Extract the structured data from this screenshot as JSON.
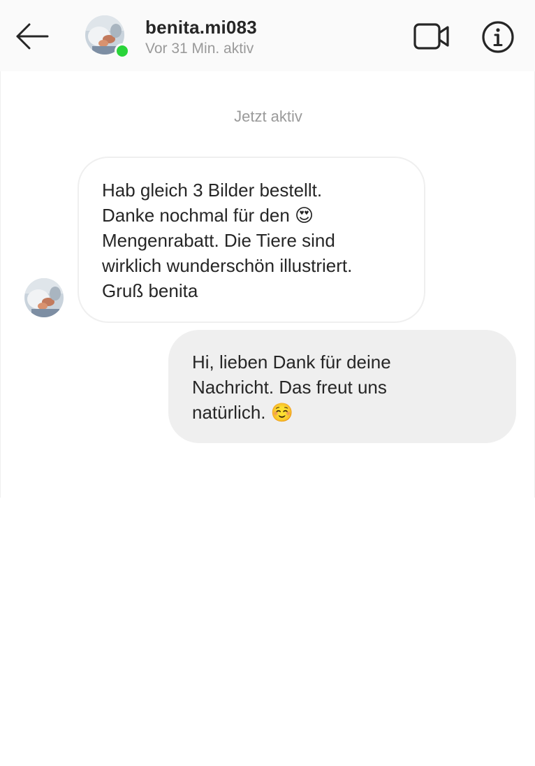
{
  "header": {
    "username": "benita.mi083",
    "status": "Vor 31 Min. aktiv",
    "online_color": "#2ad43a",
    "back_icon": "arrow-left-icon",
    "video_icon": "video-camera-icon",
    "info_icon": "info-circle-icon"
  },
  "thread": {
    "timestamp": "Jetzt aktiv",
    "messages": [
      {
        "direction": "incoming",
        "text": "Hab gleich 3 Bilder bestellt.\nDanke nochmal für den 😍\nMengenrabatt. Die Tiere sind\nwirklich wunderschön illustriert.\nGruß benita"
      },
      {
        "direction": "outgoing",
        "text": "Hi, lieben Dank für deine\nNachricht. Das freut uns\nnatürlich. ☺️"
      }
    ]
  }
}
